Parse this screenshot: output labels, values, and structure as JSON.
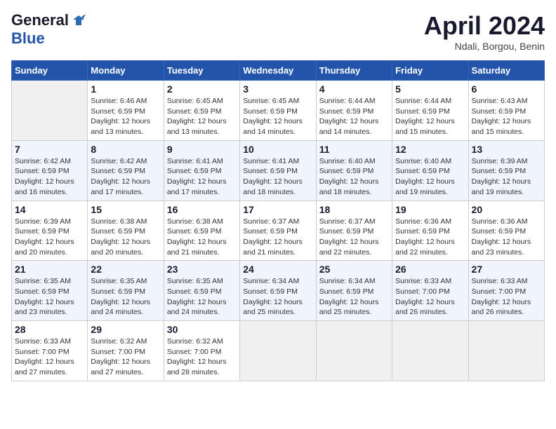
{
  "header": {
    "logo_general": "General",
    "logo_blue": "Blue",
    "title": "April 2024",
    "location": "Ndali, Borgou, Benin"
  },
  "days_of_week": [
    "Sunday",
    "Monday",
    "Tuesday",
    "Wednesday",
    "Thursday",
    "Friday",
    "Saturday"
  ],
  "weeks": [
    [
      {
        "day": null
      },
      {
        "day": 1,
        "sunrise": "6:46 AM",
        "sunset": "6:59 PM",
        "daylight": "12 hours and 13 minutes."
      },
      {
        "day": 2,
        "sunrise": "6:45 AM",
        "sunset": "6:59 PM",
        "daylight": "12 hours and 13 minutes."
      },
      {
        "day": 3,
        "sunrise": "6:45 AM",
        "sunset": "6:59 PM",
        "daylight": "12 hours and 14 minutes."
      },
      {
        "day": 4,
        "sunrise": "6:44 AM",
        "sunset": "6:59 PM",
        "daylight": "12 hours and 14 minutes."
      },
      {
        "day": 5,
        "sunrise": "6:44 AM",
        "sunset": "6:59 PM",
        "daylight": "12 hours and 15 minutes."
      },
      {
        "day": 6,
        "sunrise": "6:43 AM",
        "sunset": "6:59 PM",
        "daylight": "12 hours and 15 minutes."
      }
    ],
    [
      {
        "day": 7,
        "sunrise": "6:42 AM",
        "sunset": "6:59 PM",
        "daylight": "12 hours and 16 minutes."
      },
      {
        "day": 8,
        "sunrise": "6:42 AM",
        "sunset": "6:59 PM",
        "daylight": "12 hours and 17 minutes."
      },
      {
        "day": 9,
        "sunrise": "6:41 AM",
        "sunset": "6:59 PM",
        "daylight": "12 hours and 17 minutes."
      },
      {
        "day": 10,
        "sunrise": "6:41 AM",
        "sunset": "6:59 PM",
        "daylight": "12 hours and 18 minutes."
      },
      {
        "day": 11,
        "sunrise": "6:40 AM",
        "sunset": "6:59 PM",
        "daylight": "12 hours and 18 minutes."
      },
      {
        "day": 12,
        "sunrise": "6:40 AM",
        "sunset": "6:59 PM",
        "daylight": "12 hours and 19 minutes."
      },
      {
        "day": 13,
        "sunrise": "6:39 AM",
        "sunset": "6:59 PM",
        "daylight": "12 hours and 19 minutes."
      }
    ],
    [
      {
        "day": 14,
        "sunrise": "6:39 AM",
        "sunset": "6:59 PM",
        "daylight": "12 hours and 20 minutes."
      },
      {
        "day": 15,
        "sunrise": "6:38 AM",
        "sunset": "6:59 PM",
        "daylight": "12 hours and 20 minutes."
      },
      {
        "day": 16,
        "sunrise": "6:38 AM",
        "sunset": "6:59 PM",
        "daylight": "12 hours and 21 minutes."
      },
      {
        "day": 17,
        "sunrise": "6:37 AM",
        "sunset": "6:59 PM",
        "daylight": "12 hours and 21 minutes."
      },
      {
        "day": 18,
        "sunrise": "6:37 AM",
        "sunset": "6:59 PM",
        "daylight": "12 hours and 22 minutes."
      },
      {
        "day": 19,
        "sunrise": "6:36 AM",
        "sunset": "6:59 PM",
        "daylight": "12 hours and 22 minutes."
      },
      {
        "day": 20,
        "sunrise": "6:36 AM",
        "sunset": "6:59 PM",
        "daylight": "12 hours and 23 minutes."
      }
    ],
    [
      {
        "day": 21,
        "sunrise": "6:35 AM",
        "sunset": "6:59 PM",
        "daylight": "12 hours and 23 minutes."
      },
      {
        "day": 22,
        "sunrise": "6:35 AM",
        "sunset": "6:59 PM",
        "daylight": "12 hours and 24 minutes."
      },
      {
        "day": 23,
        "sunrise": "6:35 AM",
        "sunset": "6:59 PM",
        "daylight": "12 hours and 24 minutes."
      },
      {
        "day": 24,
        "sunrise": "6:34 AM",
        "sunset": "6:59 PM",
        "daylight": "12 hours and 25 minutes."
      },
      {
        "day": 25,
        "sunrise": "6:34 AM",
        "sunset": "6:59 PM",
        "daylight": "12 hours and 25 minutes."
      },
      {
        "day": 26,
        "sunrise": "6:33 AM",
        "sunset": "7:00 PM",
        "daylight": "12 hours and 26 minutes."
      },
      {
        "day": 27,
        "sunrise": "6:33 AM",
        "sunset": "7:00 PM",
        "daylight": "12 hours and 26 minutes."
      }
    ],
    [
      {
        "day": 28,
        "sunrise": "6:33 AM",
        "sunset": "7:00 PM",
        "daylight": "12 hours and 27 minutes."
      },
      {
        "day": 29,
        "sunrise": "6:32 AM",
        "sunset": "7:00 PM",
        "daylight": "12 hours and 27 minutes."
      },
      {
        "day": 30,
        "sunrise": "6:32 AM",
        "sunset": "7:00 PM",
        "daylight": "12 hours and 28 minutes."
      },
      {
        "day": null
      },
      {
        "day": null
      },
      {
        "day": null
      },
      {
        "day": null
      }
    ]
  ],
  "labels": {
    "sunrise_prefix": "Sunrise:",
    "sunset_prefix": "Sunset:",
    "daylight_prefix": "Daylight:"
  }
}
